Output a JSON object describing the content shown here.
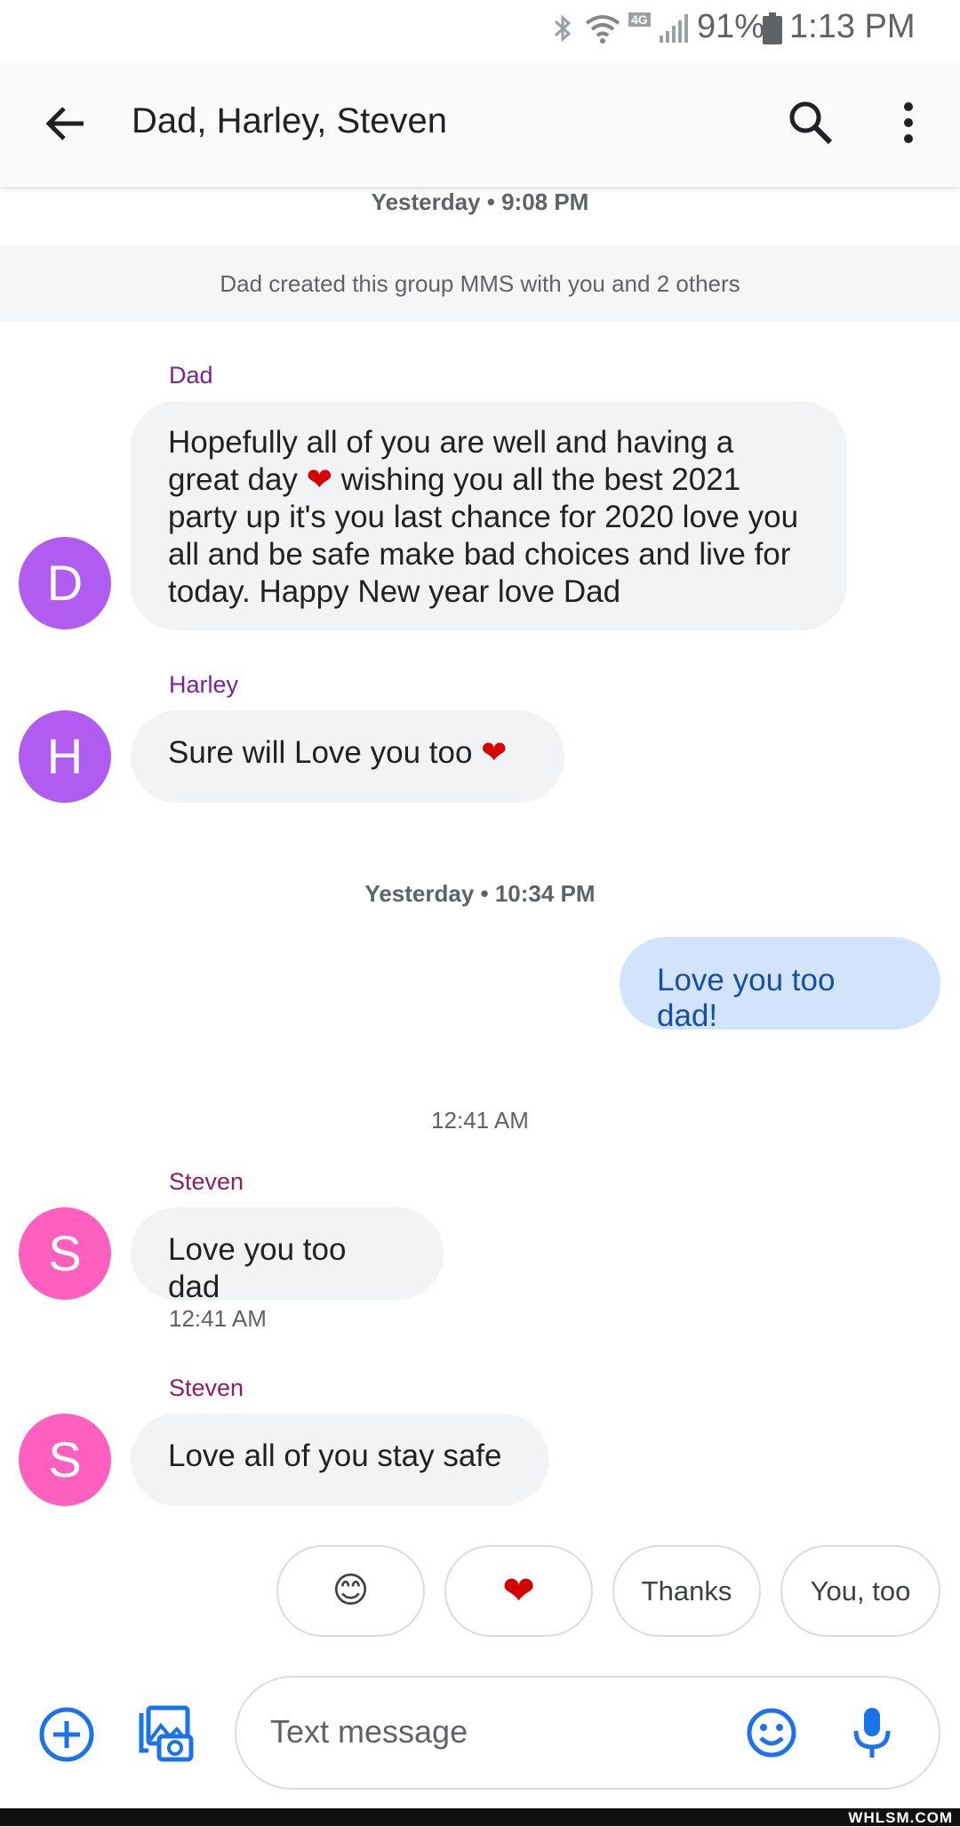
{
  "status_bar": {
    "network": "4G",
    "battery": "91%",
    "time": "1:13 PM",
    "icons": [
      "bluetooth-icon",
      "wifi-icon",
      "signal-icon",
      "battery-icon"
    ]
  },
  "app_bar": {
    "title": "Dad, Harley, Steven",
    "icons": [
      "back-arrow-icon",
      "search-icon",
      "more-vert-icon"
    ]
  },
  "conversation": {
    "timestamp_1": "Yesterday • 9:08 PM",
    "system_message": "Dad created this group MMS with you and 2 others",
    "messages": [
      {
        "sender": "Dad",
        "avatar": "D",
        "lines": [
          "Hopefully all of you are well and having a",
          "great day ❤ wishing you all the best 2021",
          "party up it's you last chance for 2020 love you",
          "all and be safe make bad choices and live for",
          "today. Happy New year love Dad"
        ]
      },
      {
        "sender": "Harley",
        "avatar": "H",
        "text": "Sure will Love you too ❤"
      }
    ],
    "timestamp_2": "Yesterday • 10:34 PM",
    "outgoing": "Love you too dad!",
    "timestamp_3": "12:41 AM",
    "steven_1": {
      "sender": "Steven",
      "avatar": "S",
      "text": "Love you too dad",
      "time": "12:41 AM"
    },
    "steven_2": {
      "sender": "Steven",
      "avatar": "S",
      "text": "Love all of you stay safe"
    }
  },
  "smart_replies": [
    "😊",
    "❤",
    "Thanks",
    "You, too"
  ],
  "composer": {
    "placeholder": "Text message",
    "icons": [
      "add-icon",
      "gallery-camera-icon",
      "emoji-icon",
      "mic-icon"
    ]
  },
  "watermark": "WHLSM.COM",
  "colors": {
    "accent": "#1a73e8",
    "incoming_bubble": "#f1f3f4",
    "outgoing_bubble": "#d2e3fc",
    "avatar_purple": "#b15cf0",
    "avatar_pink": "#ff60bf",
    "heart": "#d50000"
  }
}
